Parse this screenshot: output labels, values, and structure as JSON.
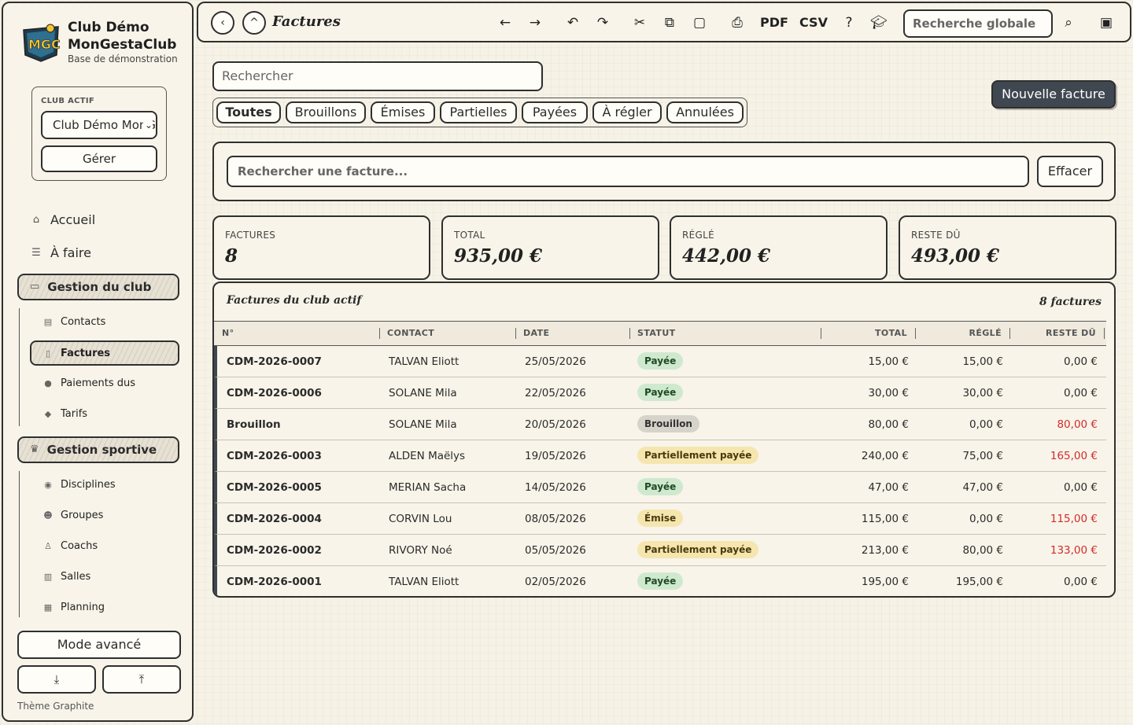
{
  "app": {
    "club_name": "Club Démo MonGestaClub",
    "club_subtitle": "Base de démonstration",
    "logo_text": "MGC"
  },
  "sidebar": {
    "active_club_label": "CLUB ACTIF",
    "active_club_value": "Club Démo MonGestaClub",
    "manage_label": "Gérer",
    "home": "Accueil",
    "todo": "À faire",
    "section_club": "Gestion du club",
    "club_items": [
      "Contacts",
      "Factures",
      "Paiements dus",
      "Tarifs"
    ],
    "section_sport": "Gestion sportive",
    "sport_items": [
      "Disciplines",
      "Groupes",
      "Coachs",
      "Salles",
      "Planning"
    ],
    "advanced_mode": "Mode avancé",
    "theme": "Thème Graphite"
  },
  "topbar": {
    "title": "Factures",
    "pdf": "PDF",
    "csv": "CSV",
    "global_search_placeholder": "Recherche globale"
  },
  "main": {
    "search_placeholder": "Rechercher",
    "new_invoice": "Nouvelle facture",
    "tabs": [
      "Toutes",
      "Brouillons",
      "Émises",
      "Partielles",
      "Payées",
      "À régler",
      "Annulées"
    ],
    "invoice_search_placeholder": "Rechercher une facture...",
    "clear": "Effacer",
    "stats": [
      {
        "label": "FACTURES",
        "value": "8"
      },
      {
        "label": "TOTAL",
        "value": "935,00 €"
      },
      {
        "label": "RÉGLÉ",
        "value": "442,00 €"
      },
      {
        "label": "RESTE DÛ",
        "value": "493,00 €"
      }
    ],
    "table": {
      "title": "Factures du club actif",
      "count": "8 factures",
      "columns": [
        "N°",
        "CONTACT",
        "DATE",
        "STATUT",
        "TOTAL",
        "RÉGLÉ",
        "RESTE DÛ"
      ],
      "rows": [
        {
          "num": "CDM-2026-0007",
          "contact": "TALVAN Eliott",
          "date": "25/05/2026",
          "status": "Payée",
          "total": "15,00 €",
          "paid": "15,00 €",
          "due": "0,00 €"
        },
        {
          "num": "CDM-2026-0006",
          "contact": "SOLANE Mila",
          "date": "22/05/2026",
          "status": "Payée",
          "total": "30,00 €",
          "paid": "30,00 €",
          "due": "0,00 €"
        },
        {
          "num": "Brouillon",
          "contact": "SOLANE Mila",
          "date": "20/05/2026",
          "status": "Brouillon",
          "total": "80,00 €",
          "paid": "0,00 €",
          "due": "80,00 €"
        },
        {
          "num": "CDM-2026-0003",
          "contact": "ALDEN Maëlys",
          "date": "19/05/2026",
          "status": "Partiellement payée",
          "total": "240,00 €",
          "paid": "75,00 €",
          "due": "165,00 €"
        },
        {
          "num": "CDM-2026-0005",
          "contact": "MERIAN Sacha",
          "date": "14/05/2026",
          "status": "Payée",
          "total": "47,00 €",
          "paid": "47,00 €",
          "due": "0,00 €"
        },
        {
          "num": "CDM-2026-0004",
          "contact": "CORVIN Lou",
          "date": "08/05/2026",
          "status": "Émise",
          "total": "115,00 €",
          "paid": "0,00 €",
          "due": "115,00 €"
        },
        {
          "num": "CDM-2026-0002",
          "contact": "RIVORY Noé",
          "date": "05/05/2026",
          "status": "Partiellement payée",
          "total": "213,00 €",
          "paid": "80,00 €",
          "due": "133,00 €"
        },
        {
          "num": "CDM-2026-0001",
          "contact": "TALVAN Eliott",
          "date": "02/05/2026",
          "status": "Payée",
          "total": "195,00 €",
          "paid": "195,00 €",
          "due": "0,00 €"
        }
      ]
    }
  },
  "colors": {
    "accent": "#3f4750",
    "due_red": "#d12b2b",
    "paid_green": "#cfe9cf",
    "partial_yellow": "#f5e6b0"
  }
}
